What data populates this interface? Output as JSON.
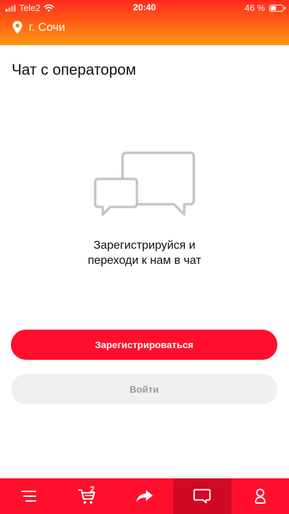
{
  "status_bar": {
    "carrier": "Tele2",
    "time": "20:40",
    "battery": "46 %",
    "battery_level": 0.46
  },
  "header": {
    "city": "г. Сочи",
    "icon": "location-pin-icon"
  },
  "page": {
    "title": "Чат с оператором",
    "illustration_icon": "chat-bubbles-icon",
    "prompt_line1": "Зарегистрируйся и",
    "prompt_line2": "переходи к нам в чат"
  },
  "buttons": {
    "register": "Зарегистрироваться",
    "login": "Войти"
  },
  "tabbar": {
    "items": [
      {
        "icon": "menu-icon",
        "active": false
      },
      {
        "icon": "cart-icon",
        "badge": "2",
        "active": false
      },
      {
        "icon": "share-icon",
        "active": false
      },
      {
        "icon": "chat-icon",
        "active": true
      },
      {
        "icon": "profile-icon",
        "active": false
      }
    ]
  },
  "colors": {
    "accent": "#ff0f2b",
    "accent_dark": "#d10a24",
    "header_gradient_top": "#ff2a1f",
    "header_gradient_bottom": "#ff9a12",
    "secondary_button_bg": "#f0f0f0",
    "secondary_button_text": "#9a9a9a",
    "illustration": "#c4c4c4"
  }
}
